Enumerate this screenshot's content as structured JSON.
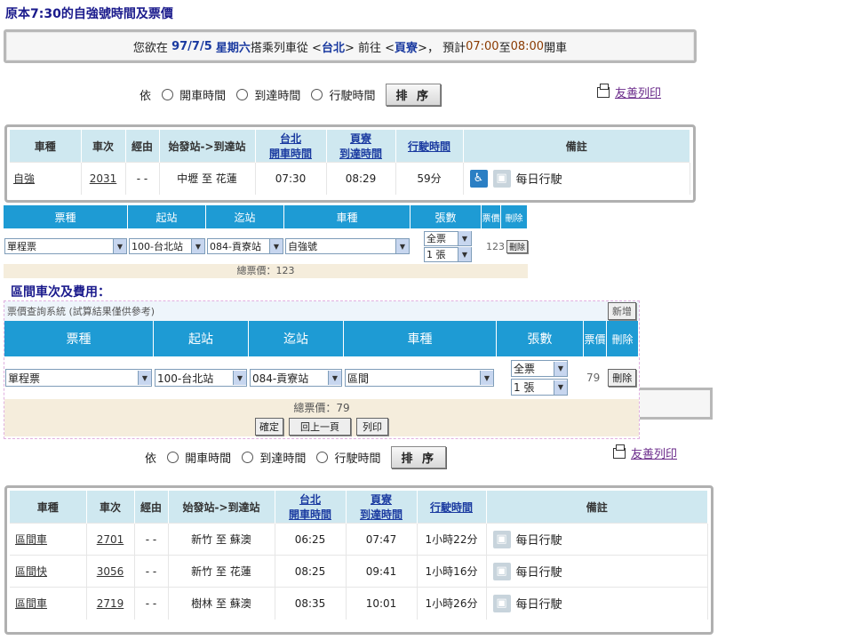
{
  "heading1": "原本7:30的自強號時間及票價",
  "heading2": "區間車次及費用：",
  "infobar": {
    "pre": "您欲在",
    "date": "97/7/5",
    "weekday": "星期六",
    "mid1": "搭乘列車從 <",
    "from": "台北",
    "mid2": "> 前往 <",
    "to": "頁寮",
    "mid3": ">，",
    "est": "預計",
    "t1": "07:00",
    "to_word": "至",
    "t2": "08:00",
    "end": "開車"
  },
  "sort": {
    "by": "依",
    "opt1": "開車時間",
    "opt2": "到達時間",
    "opt3": "行駛時間",
    "button": "排 序",
    "print": "友善列印"
  },
  "train_headers": {
    "type": "車種",
    "no": "車次",
    "via": "經由",
    "route": "始發站->到達站",
    "dep_stn": "台北",
    "dep_label": "開車時間",
    "arr_stn": "頁寮",
    "arr_label": "到達時間",
    "duration": "行駛時間",
    "remark": "備註"
  },
  "train1": {
    "type": "自強",
    "no": "2031",
    "via": "- -",
    "route": "中壢 至 花蓮",
    "dep": "07:30",
    "arr": "08:29",
    "duration": "59分",
    "remark": "每日行駛"
  },
  "fare_headers": {
    "ticket": "票種",
    "from": "起站",
    "to": "迄站",
    "train": "車種",
    "qty": "張數",
    "price": "票價",
    "delete": "刪除"
  },
  "fare1": {
    "ticket": "單程票",
    "from": "100-台北站",
    "to": "084-貢寮站",
    "train": "自強號",
    "qty_type": "全票",
    "qty_num": "1 張",
    "price": "123",
    "delete": "刪除",
    "total": "總票價：123"
  },
  "fare2": {
    "system": "票價查詢系統 (試算結果僅供參考)",
    "add": "新增",
    "ticket": "單程票",
    "from": "100-台北站",
    "to": "084-貢寮站",
    "train": "區間",
    "qty_type": "全票",
    "qty_num": "1 張",
    "price": "79",
    "delete": "刪除",
    "total": "總票價：79",
    "confirm": "確定",
    "back": "回上一頁",
    "print": "列印"
  },
  "trains2": [
    {
      "type": "區間車",
      "no": "2701",
      "via": "- -",
      "route": "新竹 至 蘇澳",
      "dep": "06:25",
      "arr": "07:47",
      "duration": "1小時22分",
      "remark": "每日行駛"
    },
    {
      "type": "區間快",
      "no": "3056",
      "via": "- -",
      "route": "新竹 至 花蓮",
      "dep": "08:25",
      "arr": "09:41",
      "duration": "1小時16分",
      "remark": "每日行駛"
    },
    {
      "type": "區間車",
      "no": "2719",
      "via": "- -",
      "route": "樹林 至 蘇澳",
      "dep": "08:35",
      "arr": "10:01",
      "duration": "1小時26分",
      "remark": "每日行駛"
    }
  ],
  "colors": {
    "header_blue": "#1e9bd4",
    "table_header": "#cfe8f0",
    "total_bg": "#f5eddc"
  }
}
